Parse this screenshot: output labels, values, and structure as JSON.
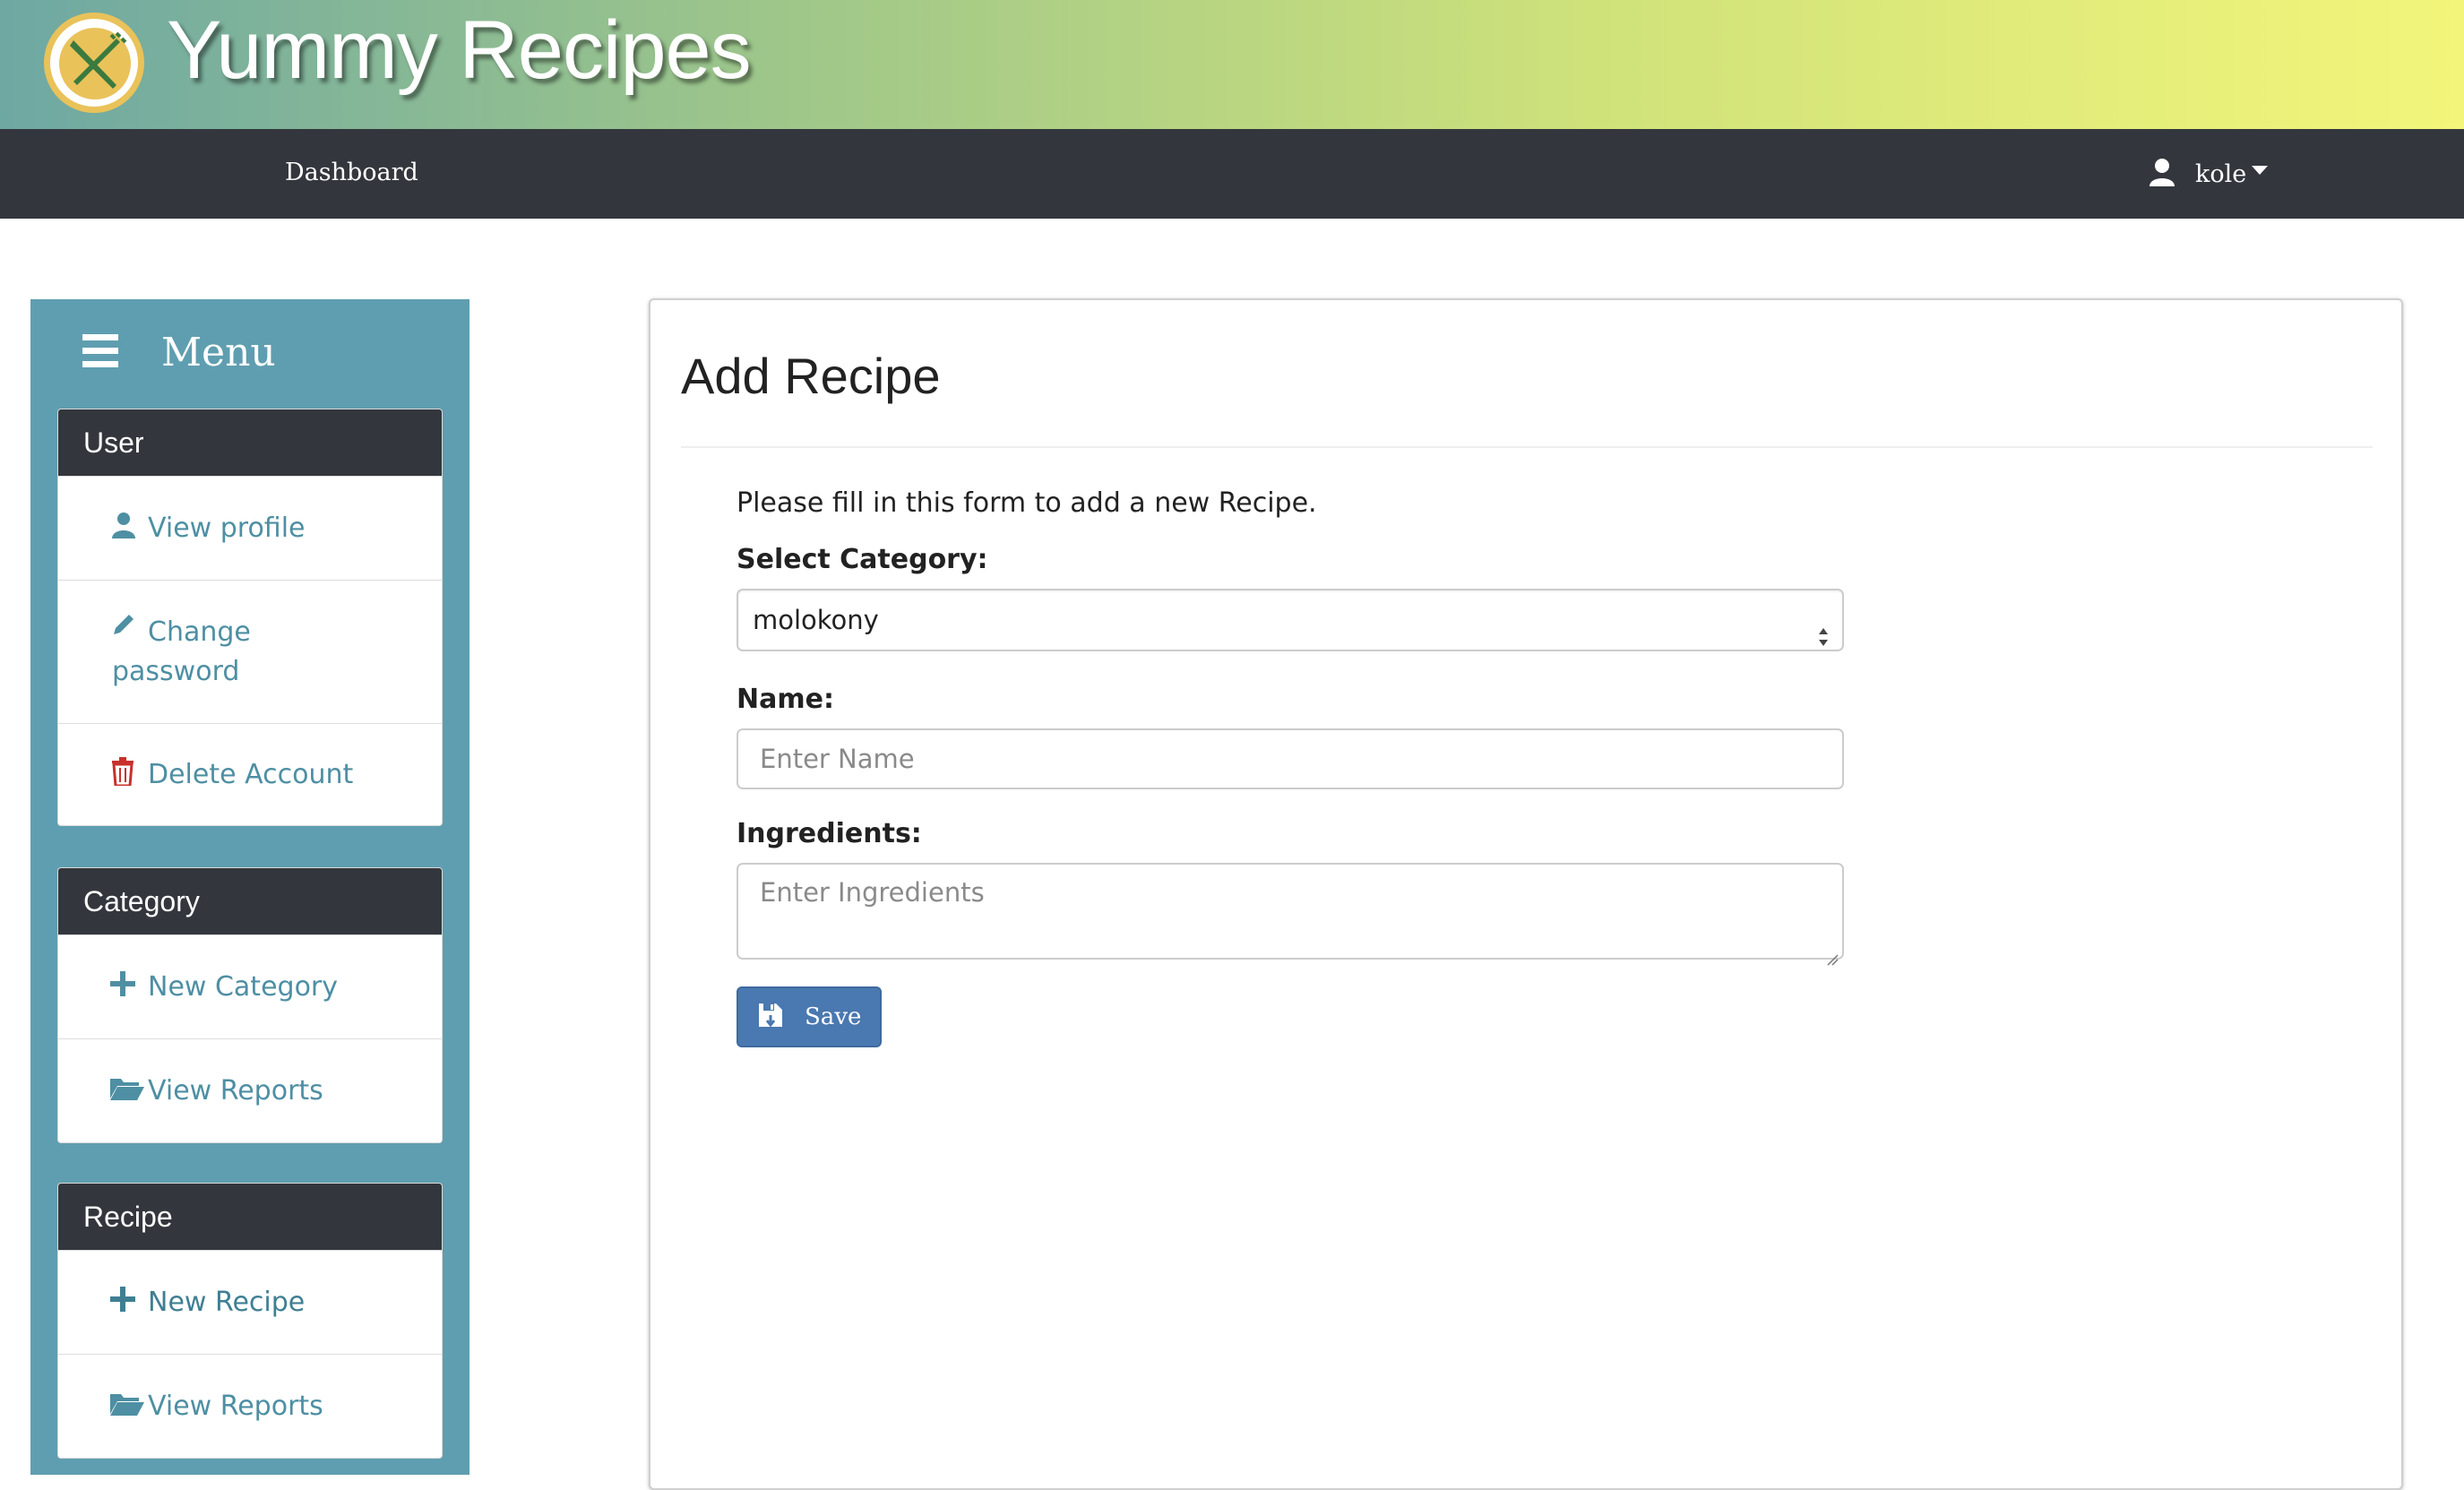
{
  "brand": {
    "title": "Yummy Recipes",
    "logo_icon": "fork-knife-icon"
  },
  "navbar": {
    "dashboard_label": "Dashboard",
    "username": "kole"
  },
  "sidebar": {
    "menu_label": "Menu",
    "sections": [
      {
        "title": "User",
        "items": [
          {
            "label": "View profile",
            "icon": "user-icon"
          },
          {
            "label": "Change password",
            "icon": "pencil-icon"
          },
          {
            "label": "Delete Account",
            "icon": "trash-icon"
          }
        ]
      },
      {
        "title": "Category",
        "items": [
          {
            "label": "New Category",
            "icon": "plus-icon"
          },
          {
            "label": "View Reports",
            "icon": "folder-open-icon"
          }
        ]
      },
      {
        "title": "Recipe",
        "items": [
          {
            "label": "New Recipe",
            "icon": "plus-icon"
          },
          {
            "label": "View Reports",
            "icon": "folder-open-icon"
          }
        ]
      }
    ]
  },
  "form": {
    "heading": "Add Recipe",
    "intro": "Please fill in this form to add a new Recipe.",
    "category_label": "Select Category:",
    "category_value": "molokony",
    "name_label": "Name:",
    "name_placeholder": "Enter Name",
    "ingredients_label": "Ingredients:",
    "ingredients_placeholder": "Enter Ingredients",
    "save_label": "Save"
  },
  "colors": {
    "navbar_bg": "#33373d",
    "sidebar_bg": "#5f9eb0",
    "link": "#4e8fa3",
    "danger_icon": "#c9302c",
    "primary_button": "#4a78b0"
  }
}
